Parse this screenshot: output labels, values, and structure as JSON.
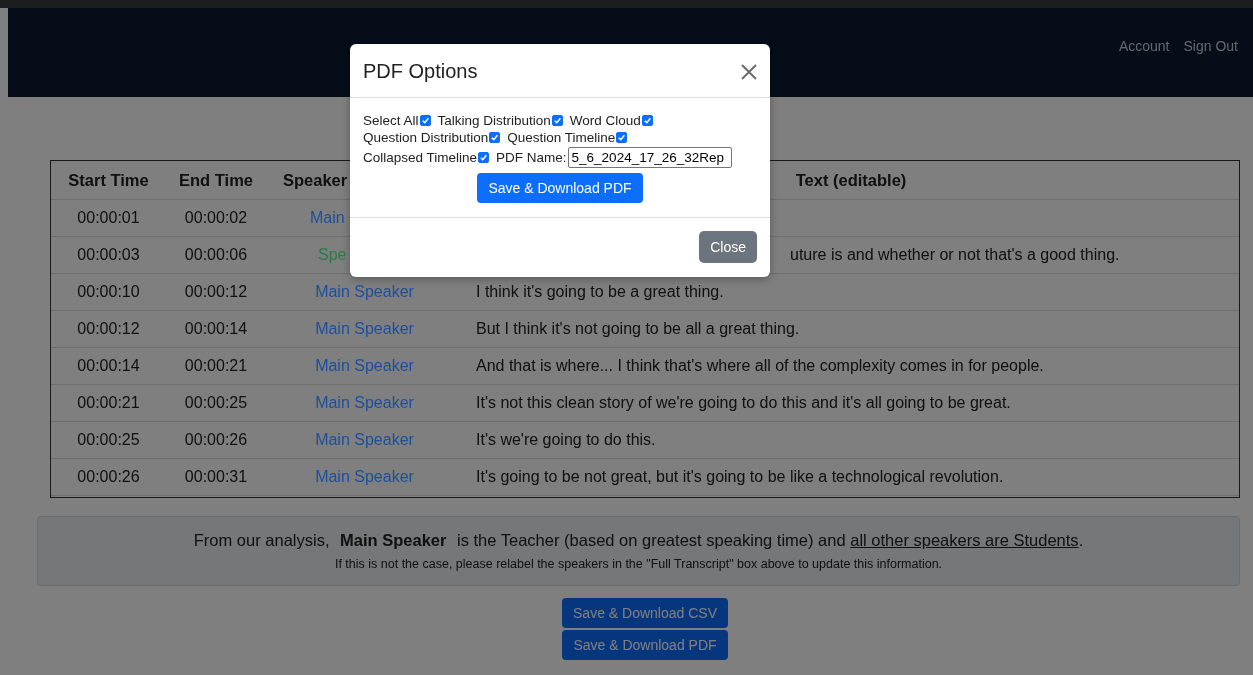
{
  "nav": {
    "links": [
      "Account",
      "Sign Out"
    ]
  },
  "table": {
    "columns": [
      "Start Time",
      "End Time",
      "Speaker",
      "Text (editable)"
    ],
    "rows": [
      {
        "kind": "covered",
        "start": "00:00:01",
        "end": "00:00:02",
        "speaker": "Main",
        "color": "#1d4f9c"
      },
      {
        "kind": "covered",
        "start": "00:00:03",
        "end": "00:00:06",
        "speaker": "Spe",
        "color": "#2e7a45",
        "text": "uture is and whether or not that's a good thing."
      },
      {
        "kind": "normal",
        "start": "00:00:10",
        "end": "00:00:12",
        "speaker": "Main Speaker",
        "color": "#1d4f9c",
        "text": "I think it's going to be a great thing."
      },
      {
        "kind": "normal",
        "start": "00:00:12",
        "end": "00:00:14",
        "speaker": "Main Speaker",
        "color": "#1d4f9c",
        "text": "But I think it's not going to be all a great thing."
      },
      {
        "kind": "normal",
        "start": "00:00:14",
        "end": "00:00:21",
        "speaker": "Main Speaker",
        "color": "#1d4f9c",
        "text": "And that is where... I think that's where all of the complexity comes in for people."
      },
      {
        "kind": "normal",
        "start": "00:00:21",
        "end": "00:00:25",
        "speaker": "Main Speaker",
        "color": "#1d4f9c",
        "text": "It's not this clean story of we're going to do this and it's all going to be great."
      },
      {
        "kind": "normal",
        "start": "00:00:25",
        "end": "00:00:26",
        "speaker": "Main Speaker",
        "color": "#1d4f9c",
        "text": "It's we're going to do this."
      },
      {
        "kind": "normal",
        "start": "00:00:26",
        "end": "00:00:31",
        "speaker": "Main Speaker",
        "color": "#1d4f9c",
        "text": "It's going to be not great, but it's going to be like a technological revolution."
      }
    ]
  },
  "summary": {
    "sentence": "From our analysis,  **Main Speaker**  is the Teacher (based on greatest speaking time) and",
    "link": "all other speakers are Students",
    "end": ".",
    "note": "If this is not the case, please relabel the speakers in the \"Full Transcript\" box above to update this information."
  },
  "buttons": [
    "Save & Download CSV",
    "Save & Download PDF"
  ],
  "modal": {
    "title": "PDF Options",
    "options": [
      {
        "label": "Select All",
        "checked": true
      },
      {
        "label": "Talking Distribution",
        "checked": true
      },
      {
        "label": "Word Cloud",
        "checked": true
      },
      {
        "label": "Question Distribution",
        "checked": true
      },
      {
        "label": "Question Timeline",
        "checked": true
      },
      {
        "label": "Collapsed Timeline",
        "checked": true
      }
    ],
    "pdf_name": {
      "label": "PDF Name:",
      "value": "5_6_2024_17_26_32Rep"
    },
    "save_button": "Save & Download PDF",
    "close_button": "Close"
  }
}
